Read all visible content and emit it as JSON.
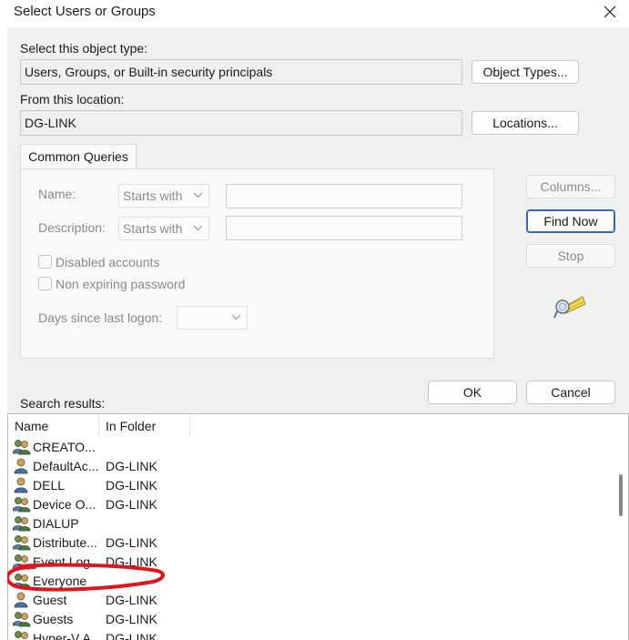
{
  "window": {
    "title": "Select Users or Groups",
    "close_icon": "close-icon"
  },
  "object_type": {
    "label": "Select this object type:",
    "value": "Users, Groups, or Built-in security principals",
    "button": "Object Types..."
  },
  "location": {
    "label": "From this location:",
    "value": "DG-LINK",
    "button": "Locations..."
  },
  "queries": {
    "tab": "Common Queries",
    "name_label": "Name:",
    "name_mode": "Starts with",
    "name_value": "",
    "description_label": "Description:",
    "description_mode": "Starts with",
    "description_value": "",
    "disabled_accounts": {
      "label": "Disabled accounts",
      "checked": false
    },
    "non_expiring_password": {
      "label": "Non expiring password",
      "checked": false
    },
    "days_label": "Days since last logon:",
    "days_value": ""
  },
  "side_buttons": {
    "columns": "Columns...",
    "find_now": "Find Now",
    "stop": "Stop",
    "search_icon": "flashlight-search-icon"
  },
  "dialog_buttons": {
    "ok": "OK",
    "cancel": "Cancel"
  },
  "results": {
    "label": "Search results:",
    "columns": [
      "Name",
      "In Folder"
    ],
    "rows": [
      {
        "name": "CREATO...",
        "folder": "",
        "icon": "group-icon"
      },
      {
        "name": "DefaultAc...",
        "folder": "DG-LINK",
        "icon": "user-icon"
      },
      {
        "name": "DELL",
        "folder": "DG-LINK",
        "icon": "user-icon"
      },
      {
        "name": "Device O...",
        "folder": "DG-LINK",
        "icon": "group-icon"
      },
      {
        "name": "DIALUP",
        "folder": "",
        "icon": "group-icon"
      },
      {
        "name": "Distribute...",
        "folder": "DG-LINK",
        "icon": "group-icon"
      },
      {
        "name": "Event Log ...",
        "folder": "DG-LINK",
        "icon": "group-icon"
      },
      {
        "name": "Everyone",
        "folder": "",
        "icon": "group-icon"
      },
      {
        "name": "Guest",
        "folder": "DG-LINK",
        "icon": "user-icon"
      },
      {
        "name": "Guests",
        "folder": "DG-LINK",
        "icon": "group-icon"
      },
      {
        "name": "Hyper-V A...",
        "folder": "DG-LINK",
        "icon": "group-icon"
      }
    ]
  },
  "colors": {
    "dialog_bg": "#f0f0f0",
    "accent": "#2f6bb5",
    "annotation": "#e0161a"
  }
}
